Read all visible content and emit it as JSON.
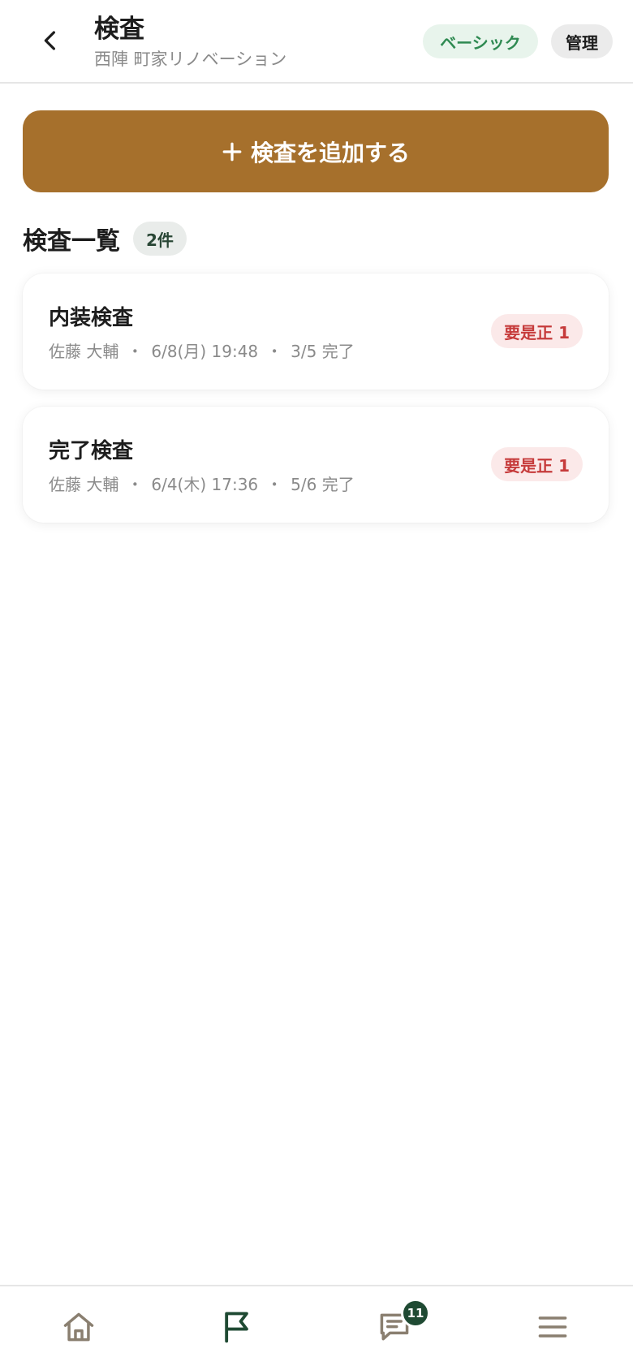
{
  "header": {
    "title": "検査",
    "subtitle": "西陣 町家リノベーション",
    "plan_badge": "ベーシック",
    "admin_badge": "管理"
  },
  "add_button": {
    "label": "検査を追加する"
  },
  "section": {
    "title": "検査一覧",
    "count": "2件"
  },
  "inspections": [
    {
      "title": "内装検査",
      "inspector": "佐藤 大輔",
      "datetime": "6/8(月) 19:48",
      "progress": "3/5 完了",
      "badge": "要是正 1"
    },
    {
      "title": "完了検査",
      "inspector": "佐藤 大輔",
      "datetime": "6/4(木) 17:36",
      "progress": "5/6 完了",
      "badge": "要是正 1"
    }
  ],
  "meta_separator": "・",
  "bottom_nav": {
    "messages_badge": "11",
    "items": [
      "home-icon",
      "flag-icon",
      "message-icon",
      "menu-icon"
    ]
  },
  "colors": {
    "accent": "#a6702c",
    "plan_badge_bg": "#e8f4ec",
    "plan_badge_text": "#2f8a52",
    "fix_badge_bg": "#fbe9e9",
    "fix_badge_text": "#c63b3b",
    "nav_active": "#1f4a33"
  }
}
